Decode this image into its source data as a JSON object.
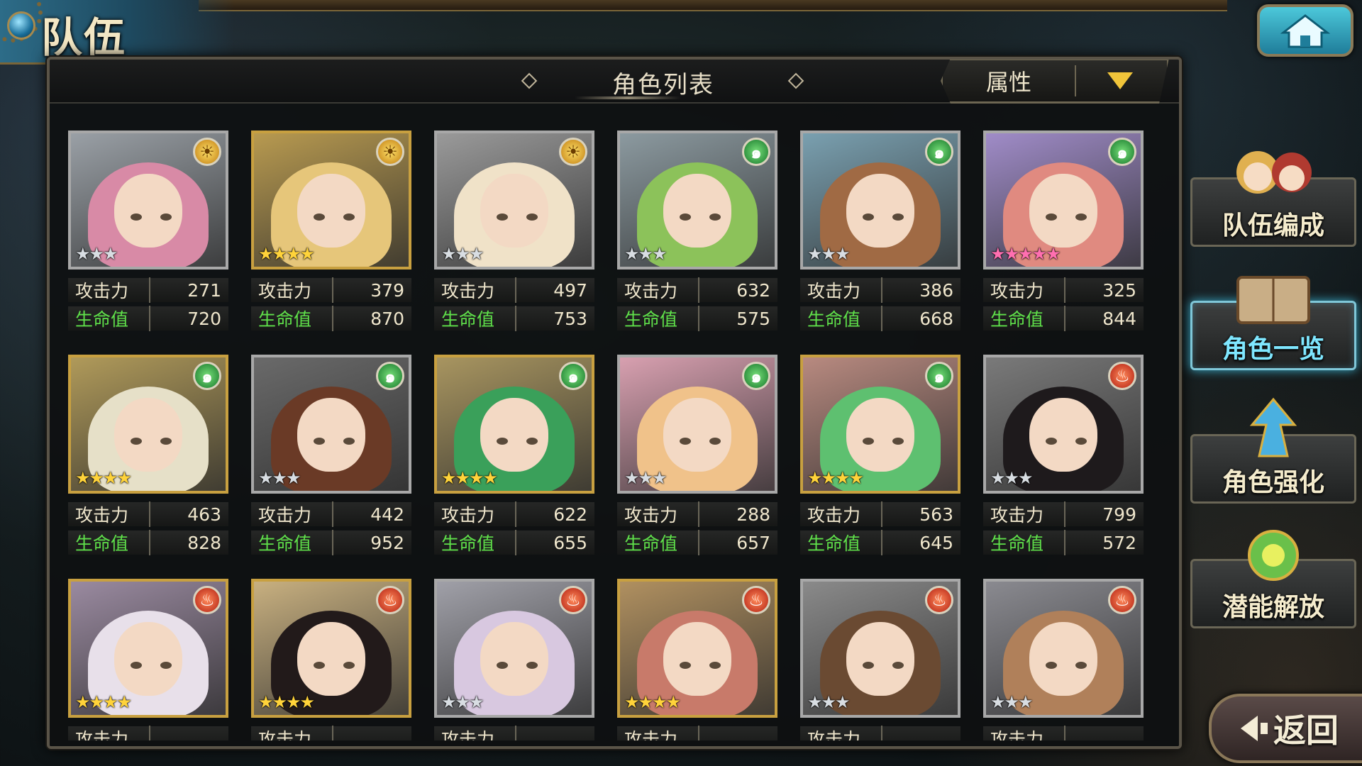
{
  "page_title": "队伍",
  "header": {
    "title": "角色列表",
    "attr_filter": "属性"
  },
  "stat_labels": {
    "atk": "攻击力",
    "hp": "生命值"
  },
  "side_menu": [
    {
      "label": "队伍编成",
      "active": false
    },
    {
      "label": "角色一览",
      "active": true
    },
    {
      "label": "角色强化",
      "active": false
    },
    {
      "label": "潜能解放",
      "active": false
    }
  ],
  "back_label": "返回",
  "characters": [
    {
      "element": "light",
      "stars": 3,
      "rarity": "silver",
      "atk": "271",
      "hp": "720",
      "hair": "#d88aa6",
      "bg": "#9aa0a6"
    },
    {
      "element": "light",
      "stars": 4,
      "rarity": "gold",
      "atk": "379",
      "hp": "870",
      "hair": "#e6c67a",
      "bg": "#b89a50"
    },
    {
      "element": "light",
      "stars": 3,
      "rarity": "silver",
      "atk": "497",
      "hp": "753",
      "hair": "#f0e2c8",
      "bg": "#9a9a9a"
    },
    {
      "element": "wind",
      "stars": 3,
      "rarity": "silver",
      "atk": "632",
      "hp": "575",
      "hair": "#8cc25a",
      "bg": "#8c9aa0"
    },
    {
      "element": "wind",
      "stars": 3,
      "rarity": "silver",
      "atk": "386",
      "hp": "668",
      "hair": "#a06a44",
      "bg": "#7aa0b0"
    },
    {
      "element": "wind",
      "stars": 5,
      "rarity": "rainbow",
      "atk": "325",
      "hp": "844",
      "hair": "#e08a80",
      "bg": "#a08cc8"
    },
    {
      "element": "wind",
      "stars": 4,
      "rarity": "gold",
      "atk": "463",
      "hp": "828",
      "hair": "#e6e0c8",
      "bg": "#b09a5a"
    },
    {
      "element": "wind",
      "stars": 3,
      "rarity": "silver",
      "atk": "442",
      "hp": "952",
      "hair": "#6a3a26",
      "bg": "#6a6a6a"
    },
    {
      "element": "wind",
      "stars": 4,
      "rarity": "gold",
      "atk": "622",
      "hp": "655",
      "hair": "#3aa05a",
      "bg": "#a89560"
    },
    {
      "element": "wind",
      "stars": 3,
      "rarity": "silver",
      "atk": "288",
      "hp": "657",
      "hair": "#f0c28a",
      "bg": "#d8a0b0"
    },
    {
      "element": "wind",
      "stars": 4,
      "rarity": "gold",
      "atk": "563",
      "hp": "645",
      "hair": "#5ec070",
      "bg": "#b88a80"
    },
    {
      "element": "fire",
      "stars": 3,
      "rarity": "silver",
      "atk": "799",
      "hp": "572",
      "hair": "#1e1a1c",
      "bg": "#7a7a7a"
    },
    {
      "element": "fire",
      "stars": 4,
      "rarity": "gold",
      "atk": "",
      "hp": "",
      "hair": "#e8e0ea",
      "bg": "#9a8aa0"
    },
    {
      "element": "fire",
      "stars": 4,
      "rarity": "gold",
      "atk": "",
      "hp": "",
      "hair": "#221a1a",
      "bg": "#c8b080"
    },
    {
      "element": "fire",
      "stars": 3,
      "rarity": "silver",
      "atk": "",
      "hp": "",
      "hair": "#d8c8e0",
      "bg": "#a0a0a8"
    },
    {
      "element": "fire",
      "stars": 4,
      "rarity": "gold",
      "atk": "",
      "hp": "",
      "hair": "#c87a6a",
      "bg": "#b09060"
    },
    {
      "element": "fire",
      "stars": 3,
      "rarity": "silver",
      "atk": "",
      "hp": "",
      "hair": "#6a4a32",
      "bg": "#8a8a8a"
    },
    {
      "element": "fire",
      "stars": 3,
      "rarity": "silver",
      "atk": "",
      "hp": "",
      "hair": "#b0805a",
      "bg": "#8a8a90"
    }
  ]
}
